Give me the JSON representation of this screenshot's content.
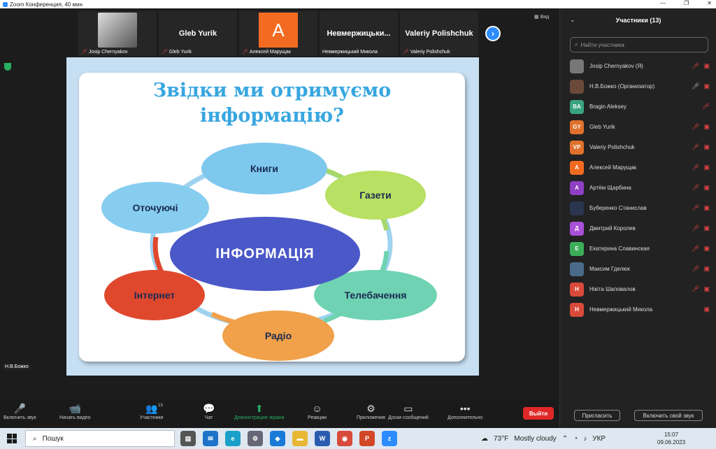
{
  "window": {
    "title": "Zoom Конференция, 40 мин",
    "controls": [
      "—",
      "❐",
      "✕"
    ]
  },
  "video_strip": {
    "tiles": [
      {
        "kind": "photo",
        "big": "",
        "name": "Josip Chernyakov",
        "muted": true
      },
      {
        "kind": "text",
        "big": "Gleb Yurik",
        "name": "Gleb Yurik",
        "muted": true
      },
      {
        "kind": "avatar",
        "big": "А",
        "name": "Алексей Марущак",
        "muted": true
      },
      {
        "kind": "text",
        "big": "Невмержицьки...",
        "name": "Невмержицький Микола",
        "muted": false
      },
      {
        "kind": "text",
        "big": "Valeriy Polishchuk",
        "name": "Valeriy Polishchuk",
        "muted": true
      }
    ],
    "view_label": "Вид"
  },
  "slide": {
    "title_line1": "Звідки ми отримуємо",
    "title_line2": "інформацію?",
    "center": "ІНФОРМАЦІЯ",
    "nodes": [
      "Книги",
      "Газети",
      "Телебачення",
      "Радіо",
      "Інтернет",
      "Оточуючі"
    ],
    "colors": {
      "books": "#7ec8ee",
      "news": "#b8e063",
      "tv": "#6fd3b3",
      "radio": "#f0a14a",
      "internet": "#e0482e",
      "people": "#86cdf0",
      "center": "#4b58c8"
    }
  },
  "self_view_label": "Н.В.Божко",
  "toolbar": {
    "items": [
      {
        "icon": "mic-off-icon",
        "glyph": "🎤",
        "label": "Включить звук"
      },
      {
        "icon": "video-off-icon",
        "glyph": "📹",
        "label": "Начать видео"
      },
      {
        "icon": "participants-icon",
        "glyph": "👥",
        "label": "Участники",
        "count": "13"
      },
      {
        "icon": "chat-icon",
        "glyph": "💬",
        "label": "Чат"
      },
      {
        "icon": "share-screen-icon",
        "glyph": "⬆",
        "label": "Демонстрация экрана"
      },
      {
        "icon": "reactions-icon",
        "glyph": "☺",
        "label": "Реакции"
      },
      {
        "icon": "apps-icon",
        "glyph": "⚙",
        "label": "Приложения"
      },
      {
        "icon": "whiteboard-icon",
        "glyph": "▭",
        "label": "Доски сообщений"
      },
      {
        "icon": "more-icon",
        "glyph": "•••",
        "label": "Дополнительно"
      }
    ],
    "leave": "Выйти"
  },
  "participants_panel": {
    "title": "Участники (13)",
    "search_placeholder": "Найти участника",
    "people": [
      {
        "initials": "",
        "color": "#777",
        "name": "Josip Chernyakov (Я)",
        "mic": "muted",
        "video": "off"
      },
      {
        "initials": "",
        "color": "#6b4a3a",
        "name": "Н.В.Божко (Организатор)",
        "mic": "on",
        "video": "off"
      },
      {
        "initials": "BA",
        "color": "#3aa37f",
        "name": "Bragin Aleksey",
        "mic": "muted",
        "video": ""
      },
      {
        "initials": "GY",
        "color": "#e0702c",
        "name": "Gleb Yurik",
        "mic": "muted",
        "video": "off"
      },
      {
        "initials": "VP",
        "color": "#e0702c",
        "name": "Valeriy Polishchuk",
        "mic": "muted",
        "video": "off"
      },
      {
        "initials": "А",
        "color": "#f26b21",
        "name": "Алексей Марущак",
        "mic": "muted",
        "video": "off"
      },
      {
        "initials": "А",
        "color": "#8e3fc4",
        "name": "Артём Щарбина",
        "mic": "muted",
        "video": "off"
      },
      {
        "initials": "",
        "color": "#2a3550",
        "name": "Буберенко Станислав",
        "mic": "muted",
        "video": "off"
      },
      {
        "initials": "Д",
        "color": "#a850d8",
        "name": "Дмитрий Королев",
        "mic": "muted",
        "video": "off"
      },
      {
        "initials": "Е",
        "color": "#3cae5a",
        "name": "Екатерина Славинская",
        "mic": "muted",
        "video": "off"
      },
      {
        "initials": "",
        "color": "#4a6a8a",
        "name": "Максим Гделюк",
        "mic": "muted",
        "video": "off"
      },
      {
        "initials": "Н",
        "color": "#d94a3a",
        "name": "Нікіта Шаповалов",
        "mic": "muted",
        "video": "off"
      },
      {
        "initials": "Н",
        "color": "#d94a3a",
        "name": "Невмержицький Микола",
        "mic": "",
        "video": "off"
      }
    ],
    "invite": "Пригласить",
    "unmute_self": "Включить свой звук"
  },
  "taskbar": {
    "search": "Пошук",
    "weather_temp": "73°F",
    "weather_text": "Mostly cloudy",
    "lang": "УКР",
    "time": "15:07",
    "date": "09.06.2023",
    "apps": [
      {
        "icon": "task-view-icon",
        "label": "▤",
        "color": "#555"
      },
      {
        "icon": "mail-icon",
        "label": "✉",
        "color": "#1e73c8"
      },
      {
        "icon": "edge-icon",
        "label": "e",
        "color": "#1aa0c8"
      },
      {
        "icon": "settings-app-icon",
        "label": "⚙",
        "color": "#667"
      },
      {
        "icon": "app-icon",
        "label": "◆",
        "color": "#1a7ad8"
      },
      {
        "icon": "files-icon",
        "label": "▬",
        "color": "#e8b834"
      },
      {
        "icon": "word-icon",
        "label": "W",
        "color": "#2a5db0"
      },
      {
        "icon": "chrome-icon",
        "label": "◉",
        "color": "#d84a3a"
      },
      {
        "icon": "powerpoint-icon",
        "label": "P",
        "color": "#d24726"
      },
      {
        "icon": "zoom-app-icon",
        "label": "z",
        "color": "#2d8cff"
      }
    ]
  }
}
